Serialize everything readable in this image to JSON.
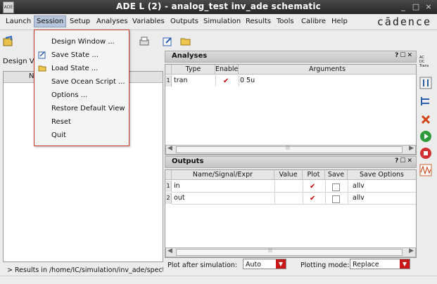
{
  "window": {
    "title": "ADE L (2) - analog_test inv_ade schematic",
    "minimize": "_",
    "close": "×",
    "maximize": "□"
  },
  "menubar": {
    "items": [
      "Launch",
      "Session",
      "Setup",
      "Analyses",
      "Variables",
      "Outputs",
      "Simulation",
      "Results",
      "Tools",
      "Calibre",
      "Help"
    ],
    "logo": "cādence"
  },
  "session_menu": {
    "items": [
      "Design Window ...",
      "Save State ...",
      "Load State ...",
      "Save Ocean Script ...",
      "Options ...",
      "Restore Default View",
      "Reset",
      "Quit"
    ]
  },
  "left_panel": {
    "label": "Design Va",
    "header": "N"
  },
  "analyses": {
    "title": "Analyses",
    "columns": [
      "Type",
      "Enable",
      "Arguments"
    ],
    "rows": [
      {
        "num": "1",
        "type": "tran",
        "enabled": true,
        "args": "0 5u"
      }
    ]
  },
  "outputs": {
    "title": "Outputs",
    "columns": [
      "Name/Signal/Expr",
      "Value",
      "Plot",
      "Save",
      "Save Options"
    ],
    "rows": [
      {
        "num": "1",
        "name": "in",
        "value": "",
        "plot": true,
        "save": false,
        "options": "allv"
      },
      {
        "num": "2",
        "name": "out",
        "value": "",
        "plot": true,
        "save": false,
        "options": "allv"
      }
    ]
  },
  "dock_buttons": "?☐✕",
  "scroll_dots": "|||",
  "bottom": {
    "plot_label": "Plot after simulation:",
    "plot_value": "Auto",
    "mode_label": "Plotting mode:",
    "mode_value": "Replace"
  },
  "right_strip": {
    "radio_labels": [
      "AC",
      "DC",
      "Trans"
    ]
  },
  "status": "> Results in /home/IC/simulation/inv_ade/spectr"
}
